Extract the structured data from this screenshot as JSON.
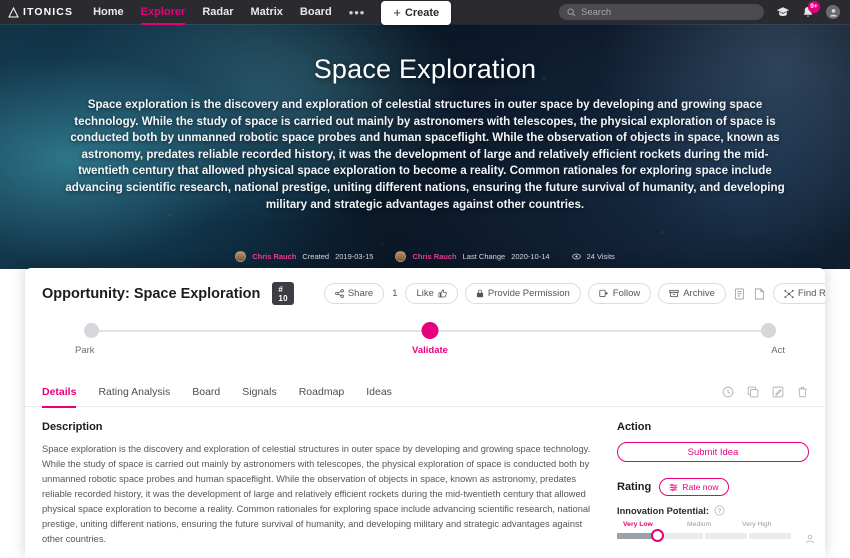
{
  "topnav": {
    "brand": "ITONICS",
    "links": [
      {
        "label": "Home",
        "active": false
      },
      {
        "label": "Explorer",
        "active": true
      },
      {
        "label": "Radar",
        "active": false
      },
      {
        "label": "Matrix",
        "active": false
      },
      {
        "label": "Board",
        "active": false
      }
    ],
    "more_label": "•••",
    "create_label": "Create",
    "create_plus": "+",
    "search_placeholder": "Search",
    "notification_badge": "9+"
  },
  "hero": {
    "title": "Space Exploration",
    "description": "Space exploration is the discovery and exploration of celestial structures in outer space by developing and growing space technology. While the study of space is carried out mainly by astronomers with telescopes, the physical exploration of space is conducted both by unmanned robotic space probes and human spaceflight. While the observation of objects in space, known as astronomy, predates reliable recorded history, it was the development of large and relatively efficient rockets during the mid-twentieth century that allowed physical space exploration to become a reality. Common rationales for exploring space include advancing scientific research, national prestige, uniting different nations, ensuring the future survival of humanity, and developing military and strategic advantages against other countries.",
    "meta": {
      "created_by": "Chris Rauch",
      "created_label": "Created",
      "created_date": "2019-03-15",
      "changed_by": "Chris Rauch",
      "changed_label": "Last Change",
      "changed_date": "2020-10-14",
      "views": "24 Visits"
    }
  },
  "card": {
    "title": "Opportunity: Space Exploration",
    "number_badge": "# 10",
    "actions": {
      "share": "Share",
      "like_count": "1",
      "like": "Like",
      "provide_permission": "Provide Permission",
      "follow": "Follow",
      "archive": "Archive",
      "find_relations": "Find Relations"
    },
    "stages": [
      {
        "label": "Park",
        "active": false,
        "pos": 0
      },
      {
        "label": "Validate",
        "active": true,
        "pos": 50
      },
      {
        "label": "Act",
        "active": false,
        "pos": 100
      }
    ],
    "tabs": [
      {
        "label": "Details",
        "active": true
      },
      {
        "label": "Rating Analysis",
        "active": false
      },
      {
        "label": "Board",
        "active": false
      },
      {
        "label": "Signals",
        "active": false
      },
      {
        "label": "Roadmap",
        "active": false
      },
      {
        "label": "Ideas",
        "active": false
      }
    ],
    "description_heading": "Description",
    "description_body": "Space exploration is the discovery and exploration of celestial structures in outer space by developing and growing space technology. While the study of space is carried out mainly by astronomers with telescopes, the physical exploration of space is conducted both by unmanned robotic space probes and human spaceflight. While the observation of objects in space, known as astronomy, predates reliable recorded history, it was the development of large and relatively efficient rockets during the mid-twentieth century that allowed physical space exploration to become a reality. Common rationales for exploring space include advancing scientific research, national prestige, uniting different nations, ensuring the future survival of humanity, and developing military and strategic advantages against other countries.",
    "sidebar": {
      "action_heading": "Action",
      "submit_idea": "Submit Idea",
      "rating_heading": "Rating",
      "rate_now": "Rate now",
      "innovation_label": "Innovation Potential:",
      "scale": [
        {
          "label": "Very Low",
          "selected": true
        },
        {
          "label": "Medium",
          "selected": false
        },
        {
          "label": "Very High",
          "selected": false
        }
      ]
    }
  },
  "colors": {
    "accent": "#e6007e",
    "nav_bg": "#2b2b2f",
    "text": "#1c1c20"
  }
}
